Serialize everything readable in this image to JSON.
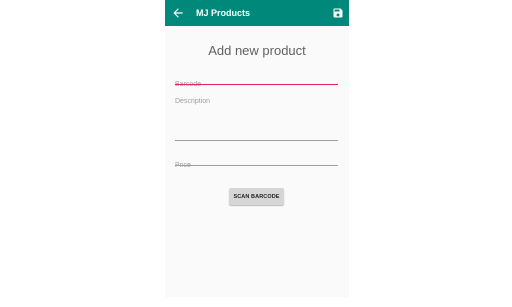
{
  "app_bar": {
    "title": "MJ Products",
    "color": "#00897b",
    "back_icon": "arrow-back-icon",
    "save_icon": "save-icon"
  },
  "form": {
    "heading": "Add new product",
    "barcode_placeholder": "Barcode",
    "barcode_value": "",
    "description_placeholder": "Description",
    "description_value": "",
    "price_placeholder": "Price",
    "price_value": "",
    "focus_accent": "#e91e63",
    "scan_button_label": "SCAN BARCODE"
  }
}
